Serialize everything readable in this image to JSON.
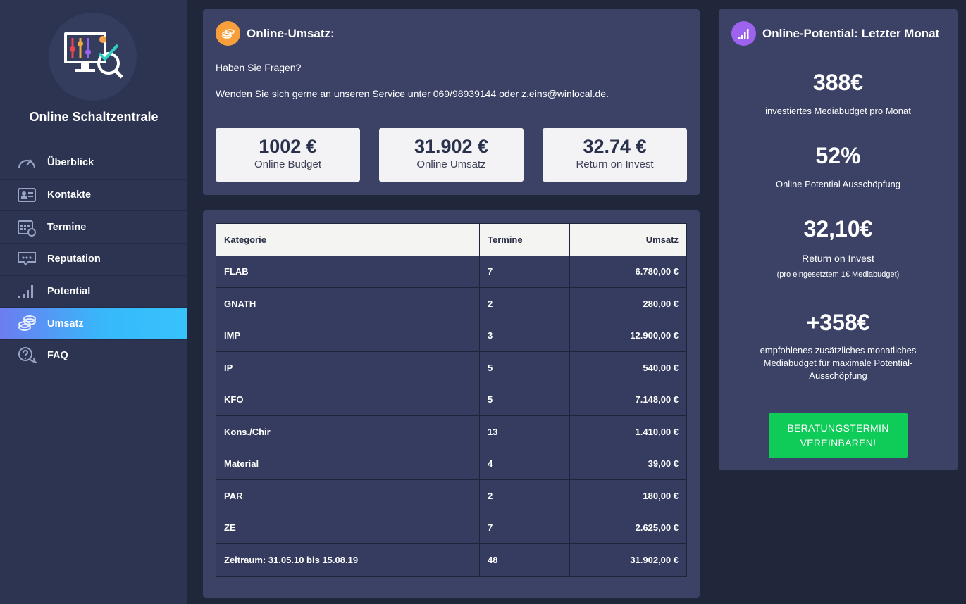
{
  "sidebar": {
    "brand": "Online Schaltzentrale",
    "logo_icon": "monitor-analytics-icon",
    "items": [
      {
        "label": "Überblick",
        "icon": "speedometer-icon",
        "active": false
      },
      {
        "label": "Kontakte",
        "icon": "contact-card-icon",
        "active": false
      },
      {
        "label": "Termine",
        "icon": "calendar-icon",
        "active": false
      },
      {
        "label": "Reputation",
        "icon": "chat-bubble-icon",
        "active": false
      },
      {
        "label": "Potential",
        "icon": "signal-bars-icon",
        "active": false
      },
      {
        "label": "Umsatz",
        "icon": "coins-icon",
        "active": true
      },
      {
        "label": "FAQ",
        "icon": "question-bubble-icon",
        "active": false
      }
    ]
  },
  "umsatz": {
    "title": "Online-Umsatz:",
    "question": "Haben Sie Fragen?",
    "contact": "Wenden Sie sich gerne an unseren Service unter 069/98939144 oder z.eins@winlocal.de.",
    "stats": [
      {
        "value": "1002 €",
        "label": "Online Budget"
      },
      {
        "value": "31.902 €",
        "label": "Online Umsatz"
      },
      {
        "value": "32.74 €",
        "label": "Return on Invest"
      }
    ]
  },
  "table": {
    "headers": [
      "Kategorie",
      "Termine",
      "Umsatz"
    ],
    "rows": [
      [
        "FLAB",
        "7",
        "6.780,00 €"
      ],
      [
        "GNATH",
        "2",
        "280,00 €"
      ],
      [
        "IMP",
        "3",
        "12.900,00 €"
      ],
      [
        "IP",
        "5",
        "540,00 €"
      ],
      [
        "KFO",
        "5",
        "7.148,00 €"
      ],
      [
        "Kons./Chir",
        "13",
        "1.410,00 €"
      ],
      [
        "Material",
        "4",
        "39,00 €"
      ],
      [
        "PAR",
        "2",
        "180,00 €"
      ],
      [
        "ZE",
        "7",
        "2.625,00 €"
      ],
      [
        "Zeitraum: 31.05.10 bis 15.08.19",
        "48",
        "31.902,00 €"
      ]
    ]
  },
  "potential": {
    "title": "Online-Potential: Letzter Monat",
    "budget_value": "388€",
    "budget_label": "investiertes Mediabudget pro Monat",
    "percent_value": "52%",
    "percent_label": "Online Potential Ausschöpfung",
    "roi_value": "32,10€",
    "roi_label": "Return on Invest",
    "roi_note": "(pro eingesetztem 1€ Mediabudget)",
    "extra_value": "+358€",
    "extra_label_1": "empfohlenes zusätzliches monatliches",
    "extra_label_2": "Mediabudget für maximale Potential-",
    "extra_label_3": "Ausschöpfung",
    "cta_1": "BERATUNGSTERMIN",
    "cta_2": "VEREINBAREN!"
  }
}
